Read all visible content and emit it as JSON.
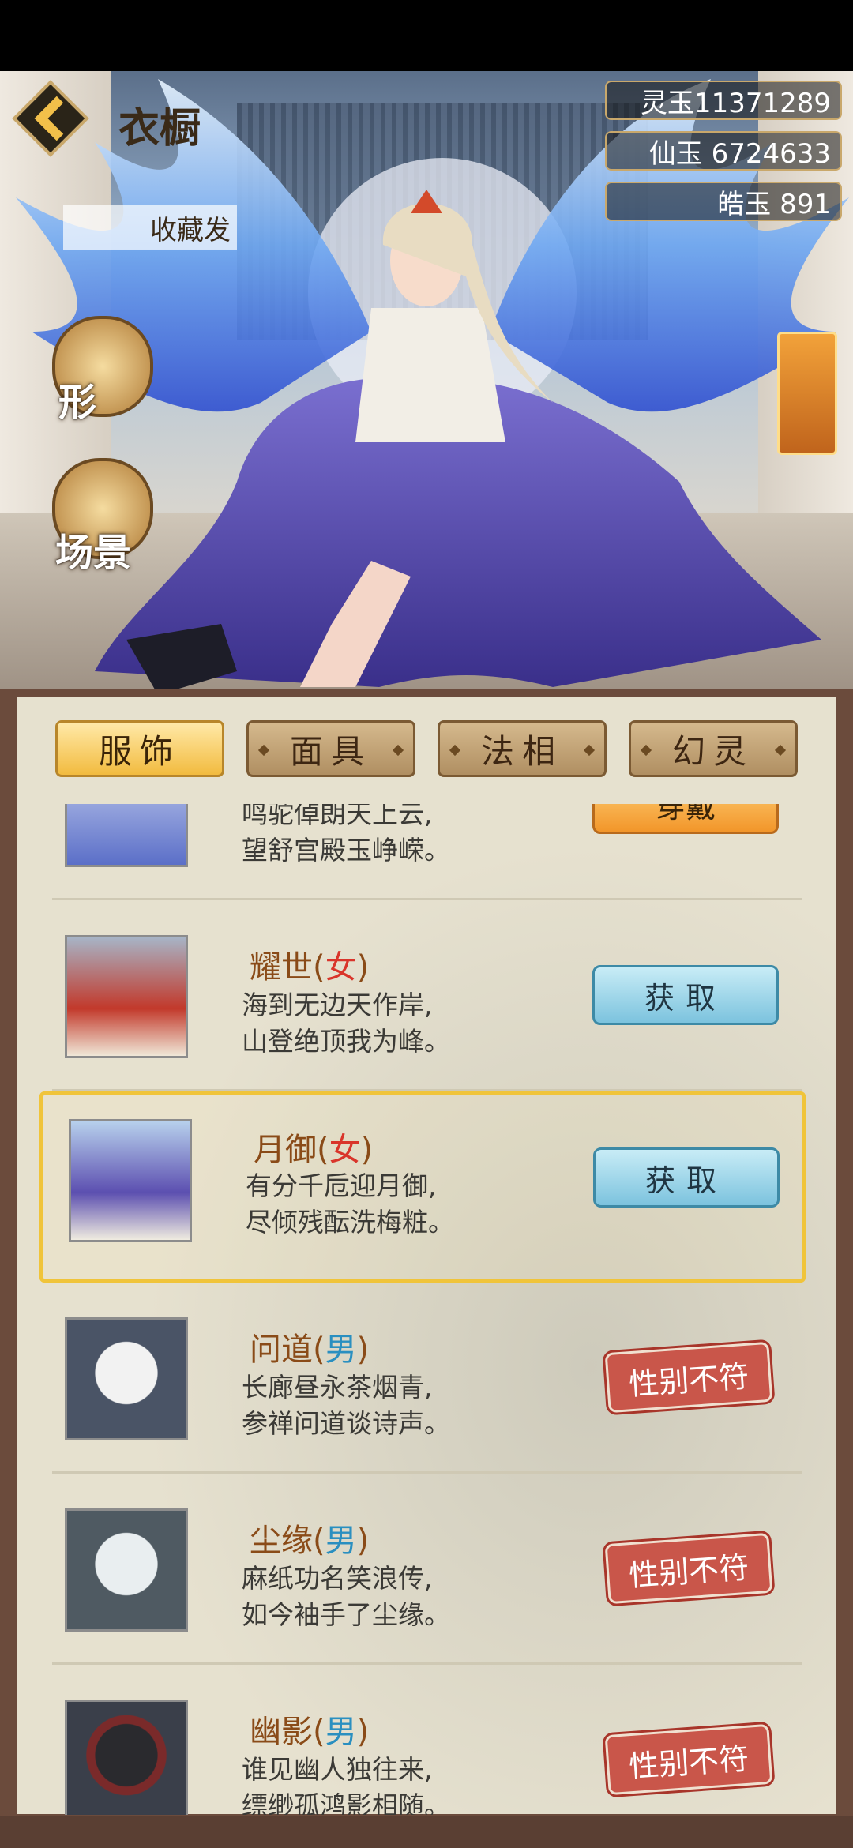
{
  "header": {
    "title": "衣橱",
    "collect_label": "收藏发"
  },
  "currencies": [
    {
      "value": "灵玉11371289"
    },
    {
      "value": "仙玉 6724633"
    },
    {
      "value": "皓玉 891"
    }
  ],
  "side_buttons": [
    {
      "label": "形"
    },
    {
      "label": "场景"
    }
  ],
  "tabs": [
    {
      "label": "服饰",
      "active": true
    },
    {
      "label": "面具",
      "active": false
    },
    {
      "label": "法相",
      "active": false
    },
    {
      "label": "幻灵",
      "active": false
    }
  ],
  "items": [
    {
      "name": "",
      "gender": "",
      "line1": "鸣驼倬朗天上云,",
      "line2": "望舒宫殿玉峥嵘。",
      "action": "穿戴",
      "action_type": "wear"
    },
    {
      "name": "耀世",
      "gender": "女",
      "line1": "海到无边天作岸,",
      "line2": "山登绝顶我为峰。",
      "action": "获取",
      "action_type": "get"
    },
    {
      "name": "月御",
      "gender": "女",
      "line1": "有分千卮迎月御,",
      "line2": "尽倾残酝洗梅粧。",
      "action": "获取",
      "action_type": "get",
      "selected": true
    },
    {
      "name": "问道",
      "gender": "男",
      "line1": "长廊昼永茶烟青,",
      "line2": "参禅问道谈诗声。",
      "action": "性别不符",
      "action_type": "mismatch"
    },
    {
      "name": "尘缘",
      "gender": "男",
      "line1": "麻纸功名笑浪传,",
      "line2": "如今袖手了尘缘。",
      "action": "性别不符",
      "action_type": "mismatch"
    },
    {
      "name": "幽影",
      "gender": "男",
      "line1": "谁见幽人独往来,",
      "line2": "缥缈孤鸿影相随。",
      "action": "性别不符",
      "action_type": "mismatch"
    }
  ],
  "colors": {
    "female": "#d9352b",
    "male": "#2a8fc0",
    "name": "#8a4b18",
    "tab_active": "#f2bb3f",
    "selected_border": "#f0c43a"
  }
}
